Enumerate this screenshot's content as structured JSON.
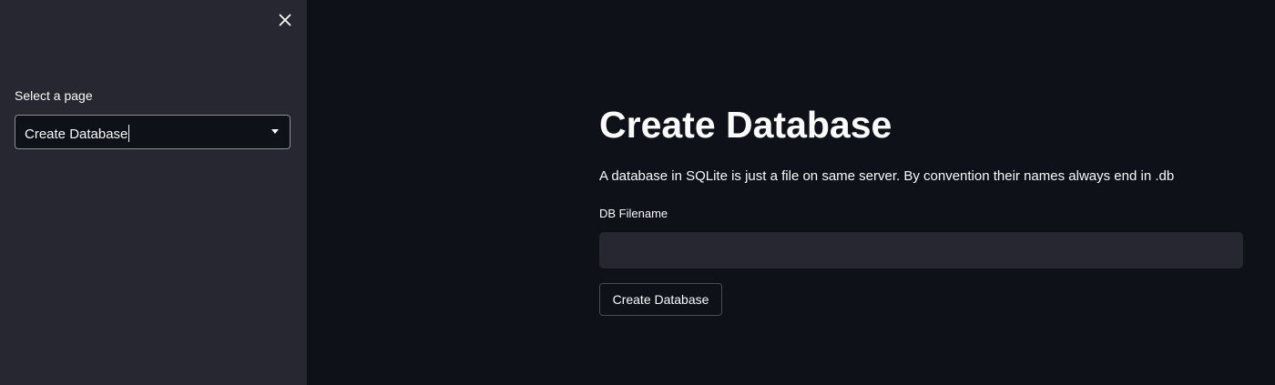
{
  "sidebar": {
    "close_icon": "close-icon",
    "select_label": "Select a page",
    "select_value": "Create Database",
    "select_arrow_icon": "caret-down-icon"
  },
  "main": {
    "title": "Create Database",
    "description": "A database in SQLite is just a file on same server. By convention their names always end in .db",
    "field_label": "DB Filename",
    "input_value": "",
    "input_placeholder": "",
    "button_label": "Create Database"
  },
  "colors": {
    "background": "#0e1117",
    "sidebar": "#262730",
    "text": "#fafafa",
    "input_background": "#262730"
  }
}
